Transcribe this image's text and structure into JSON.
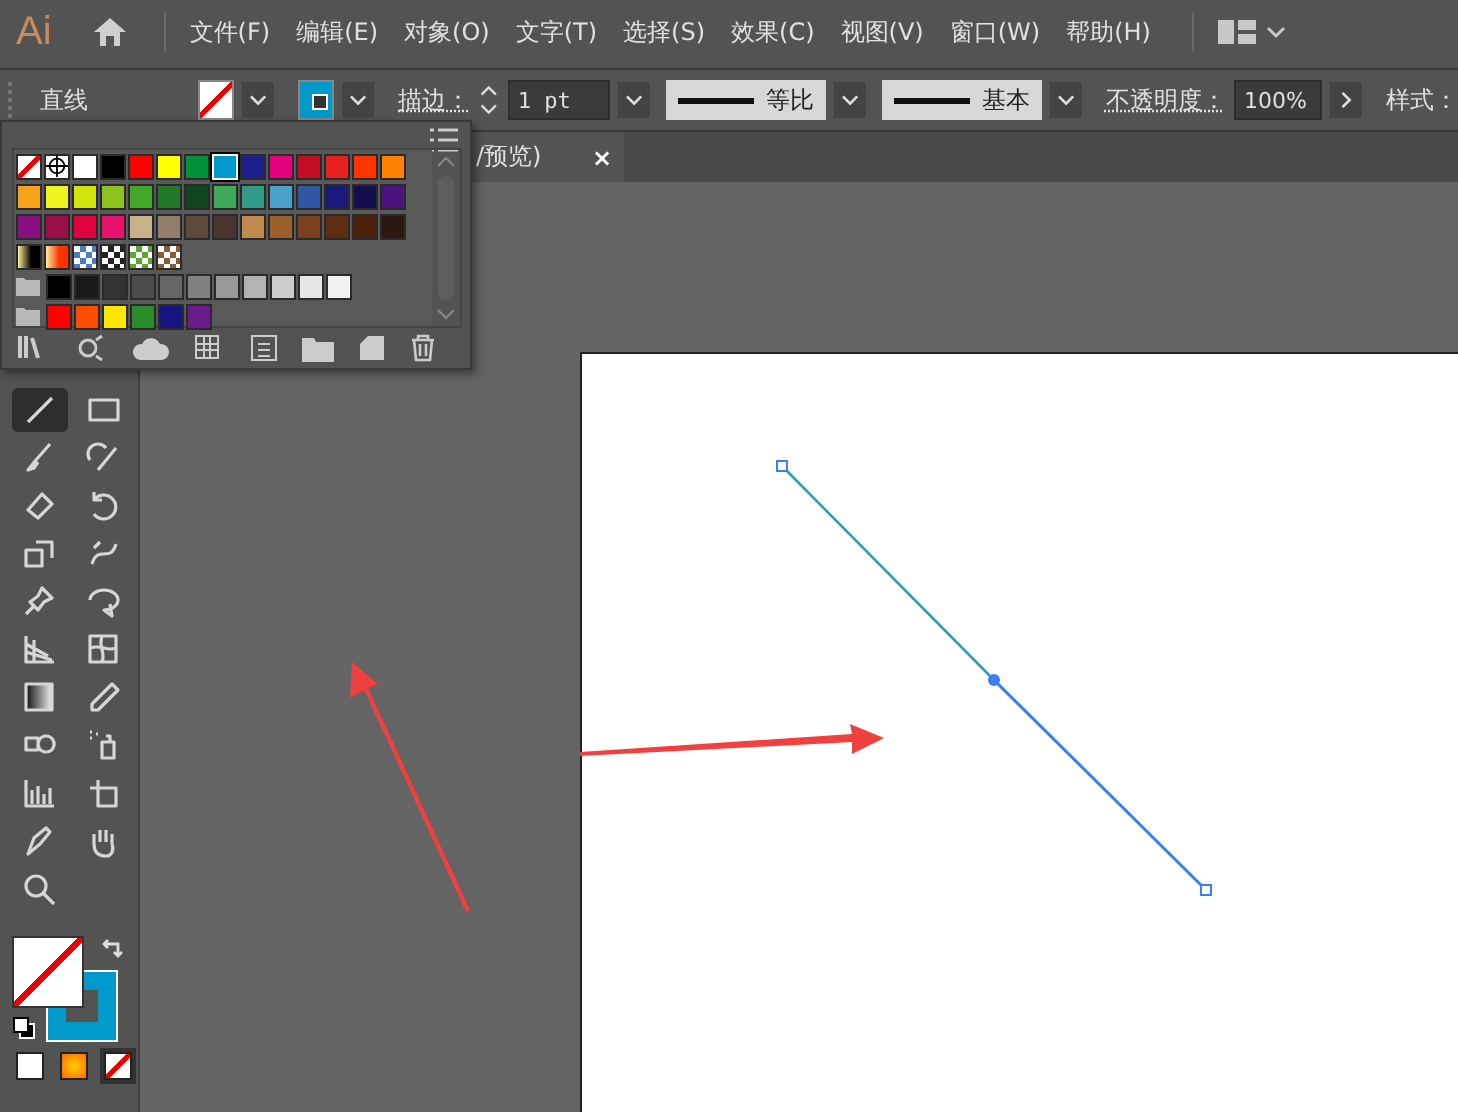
{
  "menu_bar": {
    "logo": "Ai",
    "items": [
      "文件(F)",
      "编辑(E)",
      "对象(O)",
      "文字(T)",
      "选择(S)",
      "效果(C)",
      "视图(V)",
      "窗口(W)",
      "帮助(H)"
    ]
  },
  "control_bar": {
    "tool_name": "直线",
    "fill": {
      "kind": "none"
    },
    "stroke": {
      "kind": "color",
      "color": "#0099cc"
    },
    "stroke_label": "描边：",
    "stroke_weight": "1 pt",
    "profile_1": "等比",
    "profile_2": "基本",
    "opacity_label": "不透明度：",
    "opacity_value": "100%",
    "style_label": "样式："
  },
  "document_tab": {
    "title": "/预览)",
    "close": "×"
  },
  "swatch_panel": {
    "rows": [
      {
        "group": false,
        "items": [
          {
            "kind": "none",
            "selected": false
          },
          {
            "kind": "registration",
            "selected": false
          },
          {
            "kind": "color",
            "color": "#ffffff",
            "selected": false
          },
          {
            "kind": "color",
            "color": "#000000",
            "selected": false
          },
          {
            "kind": "color",
            "color": "#ff0000",
            "selected": false
          },
          {
            "kind": "color",
            "color": "#ffff00",
            "selected": false
          },
          {
            "kind": "color",
            "color": "#00913a",
            "selected": false
          },
          {
            "kind": "color",
            "color": "#0099cc",
            "selected": true
          },
          {
            "kind": "color",
            "color": "#1d1d8c",
            "selected": false
          },
          {
            "kind": "color",
            "color": "#e4007f",
            "selected": false
          },
          {
            "kind": "color",
            "color": "#c30d23",
            "selected": false
          },
          {
            "kind": "color",
            "color": "#e8211f",
            "selected": false
          },
          {
            "kind": "color",
            "color": "#ff3300",
            "selected": false
          },
          {
            "kind": "color",
            "color": "#ff7f00",
            "selected": false
          }
        ]
      },
      {
        "group": false,
        "items": [
          {
            "kind": "color",
            "color": "#f7a21b",
            "selected": false
          },
          {
            "kind": "color",
            "color": "#f0f31e",
            "selected": false
          },
          {
            "kind": "color",
            "color": "#d0e40e",
            "selected": false
          },
          {
            "kind": "color",
            "color": "#8cc31f",
            "selected": false
          },
          {
            "kind": "color",
            "color": "#43a828",
            "selected": false
          },
          {
            "kind": "color",
            "color": "#23792a",
            "selected": false
          },
          {
            "kind": "color",
            "color": "#10461f",
            "selected": false
          },
          {
            "kind": "color",
            "color": "#3eaa5a",
            "selected": false
          },
          {
            "kind": "color",
            "color": "#319a87",
            "selected": false
          },
          {
            "kind": "color",
            "color": "#4aa2cc",
            "selected": false
          },
          {
            "kind": "color",
            "color": "#2f57a4",
            "selected": false
          },
          {
            "kind": "color",
            "color": "#191a7a",
            "selected": false
          },
          {
            "kind": "color",
            "color": "#130d4c",
            "selected": false
          },
          {
            "kind": "color",
            "color": "#4b1380",
            "selected": false
          }
        ]
      },
      {
        "group": false,
        "items": [
          {
            "kind": "color",
            "color": "#87117f",
            "selected": false
          },
          {
            "kind": "color",
            "color": "#9a0e4a",
            "selected": false
          },
          {
            "kind": "color",
            "color": "#e0023f",
            "selected": false
          },
          {
            "kind": "color",
            "color": "#e8116e",
            "selected": false
          },
          {
            "kind": "color",
            "color": "#c6b28a",
            "selected": false
          },
          {
            "kind": "color",
            "color": "#947f6a",
            "selected": false
          },
          {
            "kind": "color",
            "color": "#5e4a3a",
            "selected": false
          },
          {
            "kind": "color",
            "color": "#4a3530",
            "selected": false
          },
          {
            "kind": "color",
            "color": "#c18a4f",
            "selected": false
          },
          {
            "kind": "color",
            "color": "#9b5f2b",
            "selected": false
          },
          {
            "kind": "color",
            "color": "#7a411c",
            "selected": false
          },
          {
            "kind": "color",
            "color": "#5e2c10",
            "selected": false
          },
          {
            "kind": "color",
            "color": "#4c2008",
            "selected": false
          },
          {
            "kind": "color",
            "color": "#2c1810",
            "selected": false
          }
        ]
      },
      {
        "group": false,
        "items": [
          {
            "kind": "gradient",
            "color": "#000000",
            "selected": false
          },
          {
            "kind": "gradient",
            "color": "#ff3300",
            "selected": false
          },
          {
            "kind": "pattern",
            "color": "#4a7cc8",
            "selected": false
          },
          {
            "kind": "pattern",
            "color": "#222222",
            "selected": false
          },
          {
            "kind": "pattern",
            "color": "#5aa82a",
            "selected": false
          },
          {
            "kind": "pattern",
            "color": "#8a5a3a",
            "selected": false
          }
        ]
      },
      {
        "group": true,
        "items": [
          {
            "kind": "color",
            "color": "#000000",
            "selected": false
          },
          {
            "kind": "color",
            "color": "#1a1a1a",
            "selected": false
          },
          {
            "kind": "color",
            "color": "#333333",
            "selected": false
          },
          {
            "kind": "color",
            "color": "#4d4d4d",
            "selected": false
          },
          {
            "kind": "color",
            "color": "#666666",
            "selected": false
          },
          {
            "kind": "color",
            "color": "#808080",
            "selected": false
          },
          {
            "kind": "color",
            "color": "#999999",
            "selected": false
          },
          {
            "kind": "color",
            "color": "#b3b3b3",
            "selected": false
          },
          {
            "kind": "color",
            "color": "#cccccc",
            "selected": false
          },
          {
            "kind": "color",
            "color": "#e6e6e6",
            "selected": false
          },
          {
            "kind": "color",
            "color": "#f2f2f2",
            "selected": false
          }
        ]
      },
      {
        "group": true,
        "items": [
          {
            "kind": "color",
            "color": "#ff0000",
            "selected": false
          },
          {
            "kind": "color",
            "color": "#ff4d00",
            "selected": false
          },
          {
            "kind": "color",
            "color": "#ffe600",
            "selected": false
          },
          {
            "kind": "color",
            "color": "#2b8c2b",
            "selected": false
          },
          {
            "kind": "color",
            "color": "#141482",
            "selected": false
          },
          {
            "kind": "color",
            "color": "#6a1b8c",
            "selected": false
          }
        ]
      }
    ]
  },
  "tools": [
    [
      {
        "kind": "line",
        "selected": true
      },
      {
        "kind": "rectangle",
        "selected": false
      }
    ],
    [
      {
        "kind": "brush",
        "selected": false
      },
      {
        "kind": "shaper",
        "selected": false
      }
    ],
    [
      {
        "kind": "eraser",
        "selected": false
      },
      {
        "kind": "rotate",
        "selected": false
      }
    ],
    [
      {
        "kind": "scale",
        "selected": false
      },
      {
        "kind": "puppet",
        "selected": false
      }
    ],
    [
      {
        "kind": "pin",
        "selected": false
      },
      {
        "kind": "bubble",
        "selected": false
      }
    ],
    [
      {
        "kind": "perspective",
        "selected": false
      },
      {
        "kind": "mesh",
        "selected": false
      }
    ],
    [
      {
        "kind": "gradient",
        "selected": false
      },
      {
        "kind": "eyedropper",
        "selected": false
      }
    ],
    [
      {
        "kind": "blend",
        "selected": false
      },
      {
        "kind": "sprayer",
        "selected": false
      }
    ],
    [
      {
        "kind": "graph",
        "selected": false
      },
      {
        "kind": "artboard",
        "selected": false
      }
    ],
    [
      {
        "kind": "knife",
        "selected": false
      },
      {
        "kind": "hand",
        "selected": false
      }
    ],
    [
      {
        "kind": "zoom",
        "selected": false
      }
    ]
  ],
  "fill_stroke": {
    "fill": {
      "kind": "none"
    },
    "stroke": {
      "kind": "color",
      "color": "#0099cc"
    }
  },
  "color_modes": [
    {
      "kind": "color",
      "selected": false
    },
    {
      "kind": "gradient",
      "selected": false
    },
    {
      "kind": "none",
      "selected": true
    }
  ]
}
